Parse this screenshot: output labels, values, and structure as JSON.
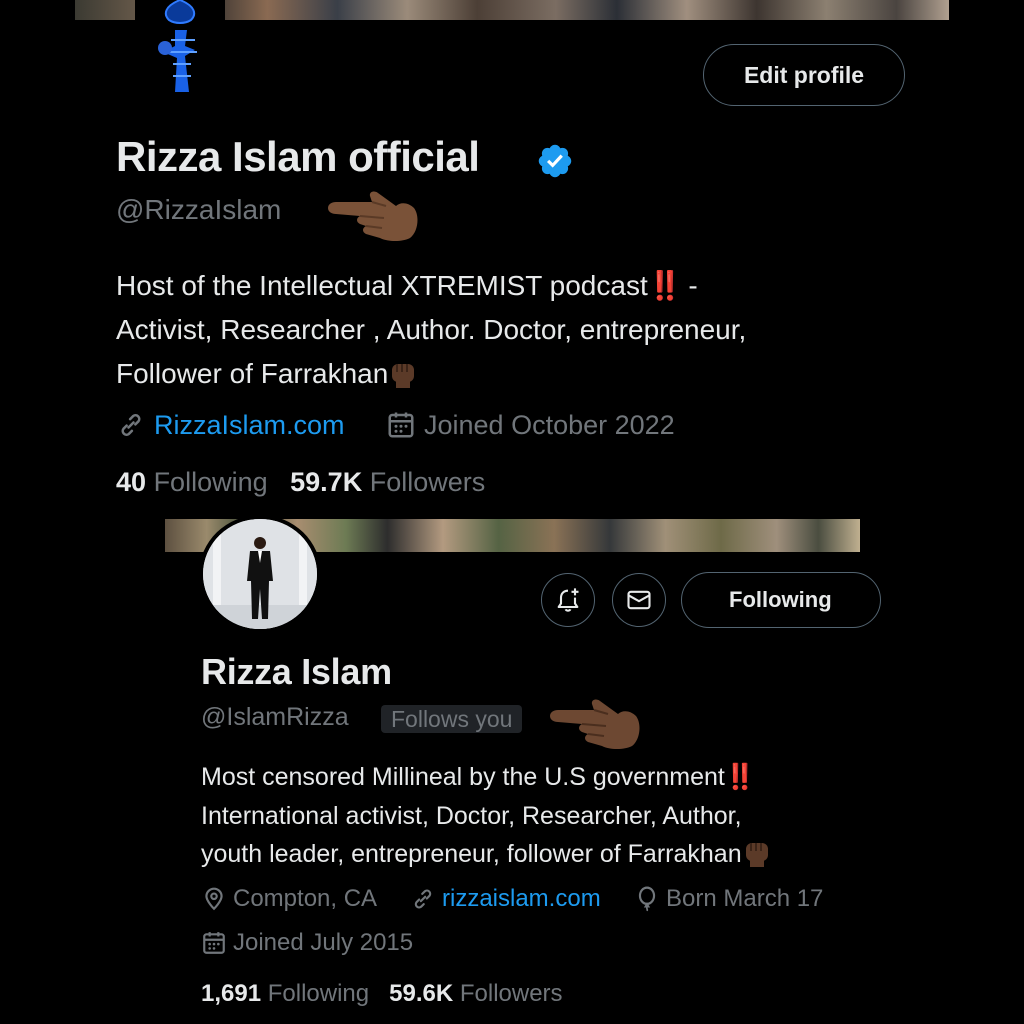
{
  "profile1": {
    "name": "Rizza Islam official",
    "handle": "@RizzaIslam",
    "edit_label": "Edit profile",
    "bio_line1": "Host of the Intellectual XTREMIST podcast",
    "bio_bang": "‼️",
    "bio_line1_end": " -",
    "bio_line2": "Activist, Researcher , Author. Doctor, entrepreneur,",
    "bio_line3": "Follower of Farrakhan",
    "website": "RizzaIslam.com",
    "joined": "Joined October 2022",
    "following_count": "40",
    "following_label": "Following",
    "followers_count": "59.7K",
    "followers_label": "Followers"
  },
  "profile2": {
    "name": "Rizza Islam",
    "handle": "@IslamRizza",
    "follows_you": "Follows you",
    "following_button": "Following",
    "bio_line1": "Most censored Millineal by the U.S government",
    "bio_bang": "‼️",
    "bio_line2": "International activist, Doctor, Researcher, Author,",
    "bio_line3": "youth leader, entrepreneur, follower of Farrakhan",
    "location": "Compton, CA",
    "website": "rizzaislam.com",
    "born": "Born March 17",
    "joined": "Joined July 2015",
    "following_count": "1,691",
    "following_label": "Following",
    "followers_count": "59.6K",
    "followers_label": "Followers"
  },
  "colors": {
    "background": "#000000",
    "text": "#e7e9ea",
    "muted": "#71767b",
    "link": "#1d9bf0",
    "verified": "#1d9bf0",
    "border": "#536471"
  },
  "icons": [
    "verified-badge-icon",
    "pointing-hand-icon",
    "raised-fist-icon",
    "link-icon",
    "calendar-icon",
    "location-pin-icon",
    "balloon-icon",
    "bell-plus-icon",
    "envelope-icon"
  ]
}
